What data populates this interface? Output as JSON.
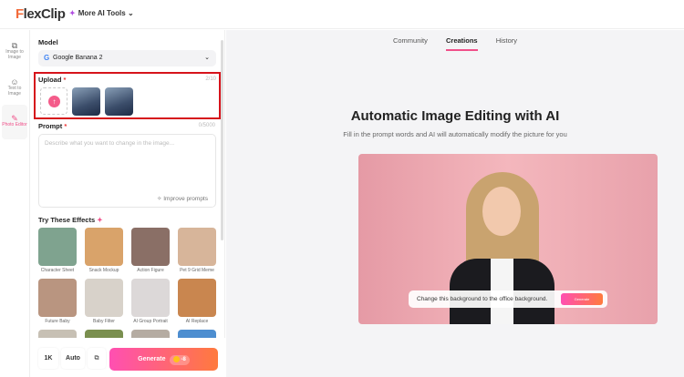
{
  "header": {
    "logo": "FlexClip",
    "more_tools": "More AI Tools"
  },
  "rail": [
    {
      "label": "Image to Image",
      "icon": "images-icon"
    },
    {
      "label": "Text to Image",
      "icon": "text-image-icon"
    },
    {
      "label": "Photo Editor",
      "icon": "photo-editor-icon",
      "active": true
    }
  ],
  "panel": {
    "model_label": "Model",
    "model_value": "Google Banana 2",
    "upload_label": "Upload",
    "upload_count": "2/10",
    "prompt_label": "Prompt",
    "prompt_count": "0/5000",
    "prompt_placeholder": "Describe what you want to change in the image...",
    "prompt_value": "",
    "improve": "Improve prompts",
    "effects_label": "Try These Effects",
    "effects": [
      {
        "label": "Character Sheet",
        "color": "#7fa38f"
      },
      {
        "label": "Snack Mockup",
        "color": "#d9a36a"
      },
      {
        "label": "Action Figure",
        "color": "#8a6f66"
      },
      {
        "label": "Pet 9 Grid Meme",
        "color": "#d7b59a"
      },
      {
        "label": "Future Baby",
        "color": "#b99580"
      },
      {
        "label": "Baby Filter",
        "color": "#d8d2ca"
      },
      {
        "label": "AI Group Portrait",
        "color": "#dcd8d8"
      },
      {
        "label": "AI Replace",
        "color": "#c9864f"
      },
      {
        "label": "",
        "color": "#c7c0b4"
      },
      {
        "label": "",
        "color": "#7a8f4f"
      },
      {
        "label": "",
        "color": "#b5aca2"
      },
      {
        "label": "",
        "color": "#4d8ed0"
      }
    ],
    "resolution": "1K",
    "ratio": "Auto",
    "generate": "Generate",
    "credits": "-8"
  },
  "main": {
    "tabs": [
      "Community",
      "Creations",
      "History"
    ],
    "active_tab": "Creations",
    "title": "Automatic Image Editing with AI",
    "subtitle": "Fill in the prompt words and AI will automatically modify the picture for you",
    "demo_prompt": "Change this background to the office background.",
    "demo_button": "Generate"
  }
}
